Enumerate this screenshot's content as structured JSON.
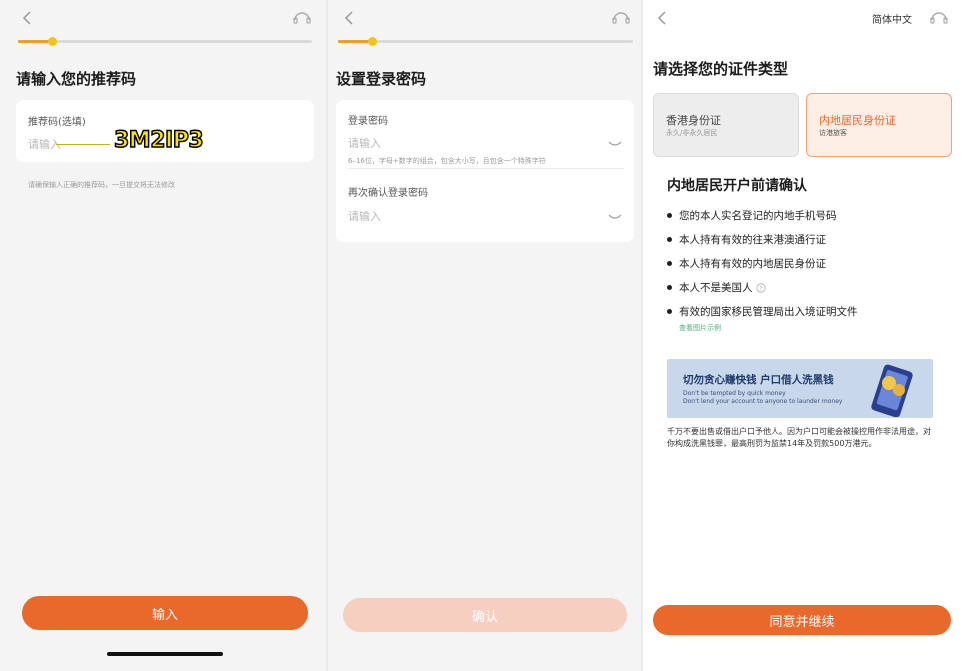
{
  "screen1": {
    "title": "请输入您的推荐码",
    "field_label": "推荐码(选填)",
    "field_placeholder": "请输入",
    "hint": "请确保输入正确的推荐码，一旦提交将无法修改",
    "annotation": "3M2IP3",
    "button": "输入",
    "progress": 0.19
  },
  "screen2": {
    "title": "设置登录密码",
    "password_label": "登录密码",
    "password_placeholder": "请输入",
    "password_hint": "6–16位，字母+数字的组合，包含大小写，且包含一个特殊字符",
    "confirm_label": "再次确认登录密码",
    "confirm_placeholder": "请输入",
    "button": "确认",
    "progress": 0.19
  },
  "screen3": {
    "language": "简体中文",
    "title": "请选择您的证件类型",
    "options": [
      {
        "title": "香港身份证",
        "subtitle": "永久/非永久居民",
        "selected": false
      },
      {
        "title": "内地居民身份证",
        "subtitle": "访港旅客",
        "selected": true
      }
    ],
    "confirm_heading": "内地居民开户前请确认",
    "requirements": [
      "您的本人实名登记的内地手机号码",
      "本人持有有效的往来港澳通行证",
      "本人持有有效的内地居民身份证",
      "本人不是美国人",
      "有效的国家移民管理局出入境证明文件"
    ],
    "example_link": "查看图片示例",
    "banner": {
      "headline": "切勿贪心赚快钱  户口借人洗黑钱",
      "line1": "Don't be tempted by quick money",
      "line2": "Don't lend your account to anyone to launder money"
    },
    "warning": "千万不要出售或借出户口予他人。因为户口可能会被操控用作非法用途，对你构成洗黑钱罪，最高刑罚为监禁14年及罚款500万港元。",
    "button": "同意并继续"
  },
  "colors": {
    "accent": "#e8692a",
    "accent_disabled": "#f7cfc0",
    "selected_bg": "#fdeee6",
    "selected_border": "#f0a17c",
    "link": "#4caf7a"
  }
}
